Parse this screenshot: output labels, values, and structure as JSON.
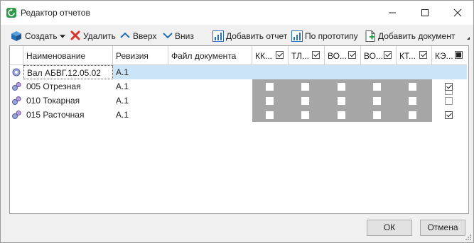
{
  "window": {
    "title": "Редактор отчетов"
  },
  "toolbar": {
    "create": "Создать",
    "delete": "Удалить",
    "up": "Вверх",
    "down": "Вниз",
    "add_report": "Добавить отчет",
    "by_prototype": "По прототипу",
    "add_document": "Добавить документ"
  },
  "table": {
    "columns": {
      "name": "Наименование",
      "revision": "Ревизия",
      "file": "Файл документа",
      "c1": "КК...",
      "c2": "ТЛ...",
      "c3": "ВО...",
      "c4": "ВО...",
      "c5": "КТ...",
      "c6": "КЭ..."
    },
    "rows": [
      {
        "name": "Вал АБВГ.12.05.02",
        "revision": "А.1",
        "file": "",
        "checks": [
          true,
          true,
          true,
          true,
          true
        ],
        "last": false
      },
      {
        "name": "005 Отрезная",
        "revision": "А.1",
        "file": "",
        "checks": [
          false,
          false,
          false,
          false,
          false
        ],
        "last": true
      },
      {
        "name": "010 Токарная",
        "revision": "А.1",
        "file": "",
        "checks": [
          false,
          false,
          false,
          false,
          false
        ],
        "last": false
      },
      {
        "name": "015 Расточная",
        "revision": "А.1",
        "file": "",
        "checks": [
          false,
          false,
          false,
          false,
          false
        ],
        "last": true
      }
    ]
  },
  "buttons": {
    "ok": "ОК",
    "cancel": "Отмена"
  },
  "colors": {
    "selection": "#cce4f7",
    "disabled_cells": "#a6a6a6",
    "accent": "#2e9c48"
  }
}
